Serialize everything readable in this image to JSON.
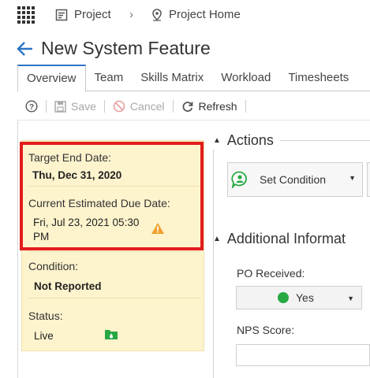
{
  "breadcrumb": {
    "project": "Project",
    "project_home": "Project Home"
  },
  "page": {
    "title": "New System Feature"
  },
  "tabs": [
    {
      "label": "Overview",
      "active": true
    },
    {
      "label": "Team"
    },
    {
      "label": "Skills Matrix"
    },
    {
      "label": "Workload"
    },
    {
      "label": "Timesheets"
    }
  ],
  "toolbar": {
    "save": "Save",
    "cancel": "Cancel",
    "refresh": "Refresh"
  },
  "summary": {
    "target_end_date_label": "Target End Date:",
    "target_end_date_value": "Thu, Dec 31, 2020",
    "current_estimated_label": "Current Estimated Due Date:",
    "current_estimated_value_line1": "Fri, Jul 23, 2021 05:30",
    "current_estimated_value_line2": "PM",
    "condition_label": "Condition:",
    "condition_value": "Not Reported",
    "status_label": "Status:",
    "status_value": "Live"
  },
  "actions": {
    "section_title": "Actions",
    "set_condition": "Set Condition"
  },
  "additional": {
    "section_title": "Additional Informat",
    "po_received_label": "PO Received:",
    "po_received_value": "Yes",
    "nps_score_label": "NPS Score:"
  },
  "colors": {
    "accent": "#2c74c6",
    "highlight_border": "#e21d1d",
    "summary_bg": "#fdf3cd",
    "warning": "#f0a030",
    "status_green": "#27a843"
  }
}
